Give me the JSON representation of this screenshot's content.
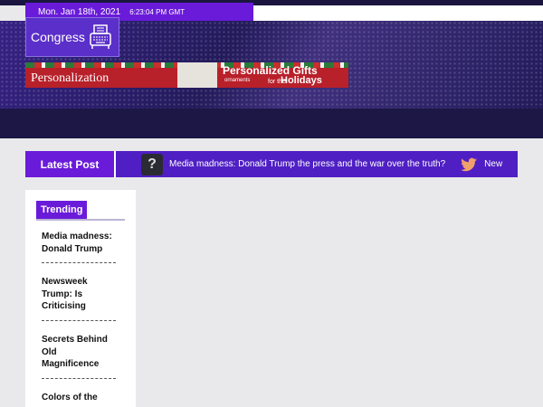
{
  "topbar": {
    "date": "Mon. Jan 18th, 2021",
    "time": "6:23:04 PM GMT"
  },
  "site": {
    "name": "Congress",
    "icon": "typewriter-icon"
  },
  "banner": {
    "brand": "Personalization",
    "headline": "Personalized Gifts",
    "sub_left": "ornaments",
    "sub_for": "for the",
    "sub_right": "Holidays"
  },
  "ticker": {
    "label": "Latest Post",
    "items": [
      {
        "text": "Media madness: Donald Trump the press and the war over the truth?",
        "icon": "question-mark-icon"
      },
      {
        "text": "New",
        "icon": "twitter-bird-icon"
      }
    ]
  },
  "trending": {
    "title": "Trending",
    "items": [
      {
        "title": "Media madness: Donald Trump"
      },
      {
        "title": "Newsweek Trump: Is Criticising"
      },
      {
        "title": "Secrets Behind Old Magnificence"
      },
      {
        "title": "Colors of the"
      }
    ]
  },
  "colors": {
    "accent": "#6a1bd9",
    "header": "#221a56",
    "ticker": "#4f1fc4",
    "background": "#e9e9eb"
  }
}
